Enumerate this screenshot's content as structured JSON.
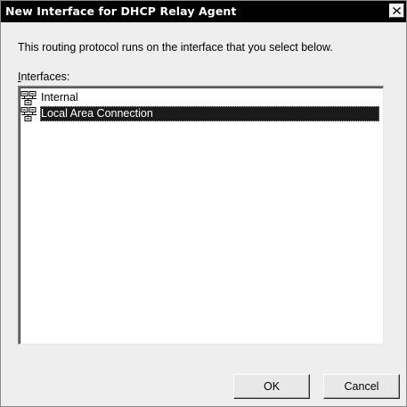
{
  "dialog": {
    "title": "New Interface for DHCP Relay Agent",
    "intro": "This routing protocol runs on the interface that you select below.",
    "list_label_accel": "I",
    "list_label_rest": "nterfaces:",
    "interfaces": [
      {
        "label": "Internal",
        "icon": "network-interface-icon",
        "selected": false
      },
      {
        "label": "Local Area Connection",
        "icon": "network-interface-icon",
        "selected": true
      }
    ],
    "ok_label": "OK",
    "cancel_label": "Cancel",
    "close_icon": "close-icon"
  },
  "colors": {
    "titlebar": "#000000",
    "dialog_bg": "#eeeeee",
    "selection_bg": "#1a1a1a"
  }
}
